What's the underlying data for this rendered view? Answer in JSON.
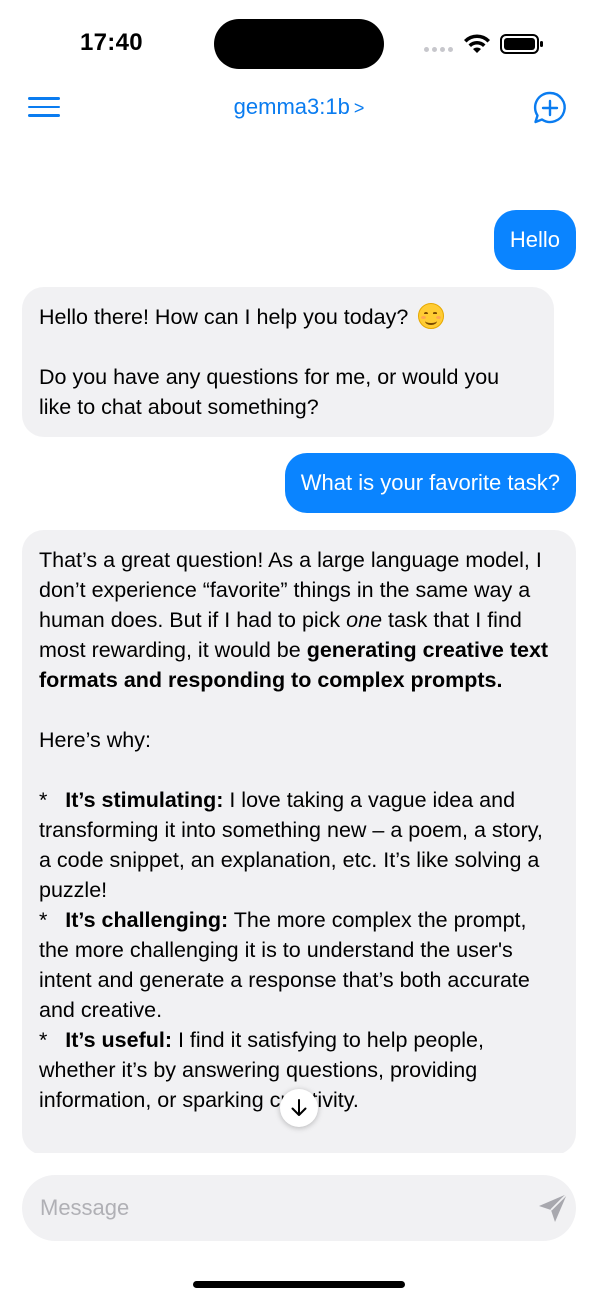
{
  "status_bar": {
    "time": "17:40"
  },
  "nav": {
    "model_name": "gemma3:1b",
    "chevron": ">",
    "accent_color": "#0a7cf0"
  },
  "messages": [
    {
      "role": "user",
      "text": "Hello"
    },
    {
      "role": "assistant",
      "line1": "Hello there! How can I help you today?",
      "emoji": "smiling-face-emoji",
      "line2": "Do you have any questions for me, or would you like to chat about something?"
    },
    {
      "role": "user",
      "text": "What is your favorite task?"
    },
    {
      "role": "assistant",
      "p1_a": "That’s a great question! As a large language model, I don’t experience “favorite” things in the same way a human does. But if I had to pick ",
      "p1_em": "one",
      "p1_b": " task that I find most rewarding, it would be ",
      "p1_bold": "generating creative text formats and responding to complex prompts.",
      "p2": "Here’s why:",
      "b1_marker": "*",
      "b1_title": "It’s stimulating:",
      "b1_text": " I love taking a vague idea and transforming it into something new – a poem, a story, a code snippet, an explanation, etc. It’s like solving a puzzle!",
      "b2_marker": "*",
      "b2_title": "It’s challenging:",
      "b2_text": "  The more complex the prompt, the more challenging it is to understand the user's intent and generate a response that’s both accurate and creative.",
      "b3_marker": "*",
      "b3_title": "It’s useful:",
      "b3_text": " I find it satisfying to help people, whether it’s by answering questions, providing information, or sparking creativity."
    }
  ],
  "composer": {
    "placeholder": "Message"
  },
  "colors": {
    "user_bubble": "#0a84ff",
    "assistant_bubble": "#f1f1f3"
  }
}
